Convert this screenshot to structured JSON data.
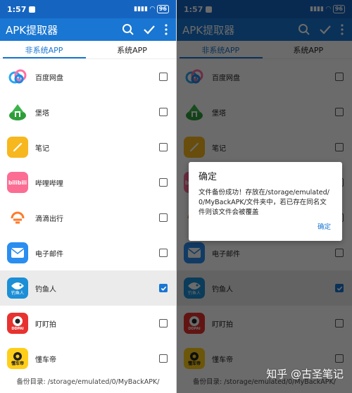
{
  "status_bar": {
    "time": "1:57",
    "battery": "96"
  },
  "app_bar": {
    "title": "APK提取器"
  },
  "tabs": [
    {
      "label": "非系统APP",
      "active": true
    },
    {
      "label": "系统APP",
      "active": false
    }
  ],
  "apps": [
    {
      "name": "百度网盘",
      "checked": false,
      "icon": "baidu-netdisk-icon"
    },
    {
      "name": "堡塔",
      "checked": false,
      "icon": "baota-icon"
    },
    {
      "name": "笔记",
      "checked": false,
      "icon": "notes-icon"
    },
    {
      "name": "哔哩哔哩",
      "checked": false,
      "icon": "bilibili-icon",
      "icon_text": "bilibili"
    },
    {
      "name": "滴滴出行",
      "checked": false,
      "icon": "didi-icon"
    },
    {
      "name": "电子邮件",
      "checked": false,
      "icon": "email-icon"
    },
    {
      "name": "钓鱼人",
      "checked": true,
      "icon": "fishing-icon",
      "icon_text": "钓鱼人"
    },
    {
      "name": "盯盯拍",
      "checked": false,
      "icon": "ddpai-icon",
      "icon_text": "DDPAI"
    },
    {
      "name": "懂车帝",
      "checked": false,
      "icon": "dongchedi-icon",
      "icon_text": "懂车帝"
    }
  ],
  "footer": {
    "text": "备份目录: /storage/emulated/0/MyBackAPK/"
  },
  "dialog": {
    "title": "确定",
    "message": "文件备份成功！存放在/storage/emulated/0/MyBackAPK/文件夹中，若已存在同名文件则该文件会被覆盖",
    "confirm_label": "确定"
  },
  "watermark": "知乎 @古圣笔记",
  "colors": {
    "primary": "#1976d2",
    "status_bar": "#1565c0",
    "selected_row": "#ebebeb"
  }
}
